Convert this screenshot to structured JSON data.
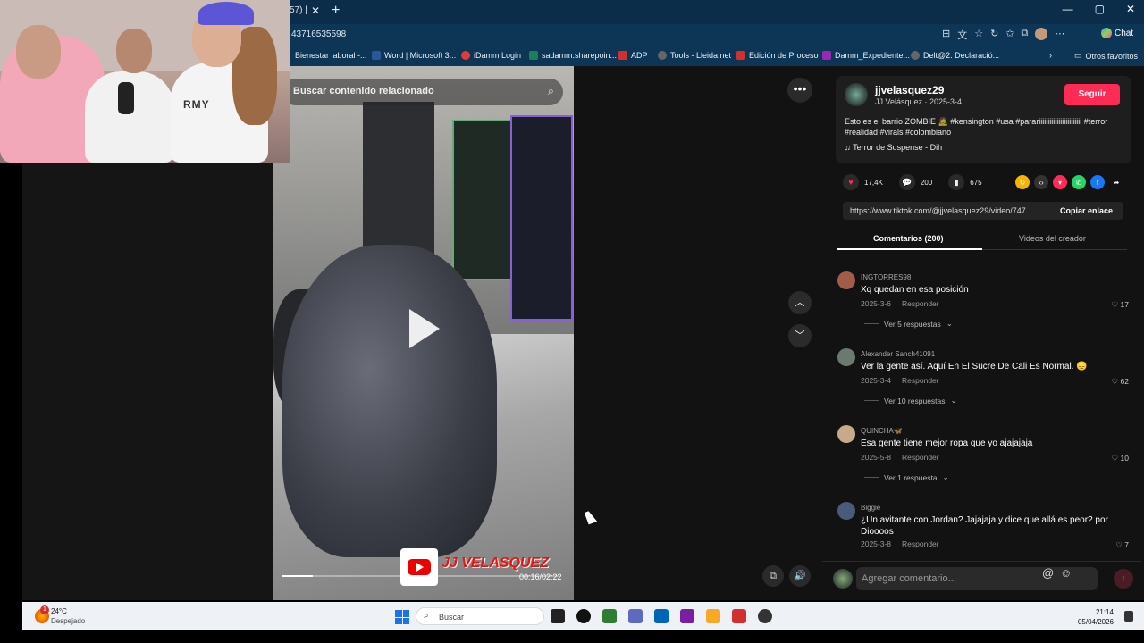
{
  "browser": {
    "tab_fragment": "57) | ",
    "tab_close": "✕",
    "new_tab": "+",
    "url_fragment": "43716535598",
    "window_controls": [
      "—",
      "▢",
      "✕"
    ],
    "chat_label": "Chat",
    "bookmarks": [
      {
        "label": "Bienestar laboral -...",
        "color": "#0b3a5c"
      },
      {
        "label": "Word | Microsoft 3...",
        "color": "#2b579a"
      },
      {
        "label": "iDamm Login",
        "color": "#e53935"
      },
      {
        "label": "sadamm.sharepoin...",
        "color": "#1b7f5b"
      },
      {
        "label": "ADP",
        "color": "#d32f2f"
      },
      {
        "label": "Tools - Lleida.net",
        "color": "#666666"
      },
      {
        "label": "Edición de Proceso",
        "color": "#d32f2f"
      },
      {
        "label": "Damm_Expediente...",
        "color": "#9c27b0"
      },
      {
        "label": "Delt@2. Declaració...",
        "color": "#666666"
      }
    ],
    "other_bookmarks": "Otros favoritos"
  },
  "video": {
    "search_placeholder": "Buscar contenido relacionado",
    "watermark": "JJ VELASQUEZ",
    "timecode": "00:16/02:22",
    "progress": 0.11,
    "more_label": "•••"
  },
  "creator": {
    "handle": "jjvelasquez29",
    "name_date": "JJ Velásquez · 2025-3-4",
    "follow_label": "Seguir",
    "caption": "Esto es el barrio ZOMBIE 🧟 #kensington #usa #parariiiiiiiiiiiiiiiiiiiiiiii #terror #realidad #virals #colombiano",
    "music": "♫  Terror de Suspense - Dih"
  },
  "stats": {
    "likes": "17,4K",
    "comments": "200",
    "saves": "675"
  },
  "link": {
    "url": "https://www.tiktok.com/@jjvelasquez29/video/747...",
    "copy_label": "Copiar enlace"
  },
  "tabs": {
    "comments_label": "Comentarios (200)",
    "creator_videos_label": "Videos del creador"
  },
  "comments": [
    {
      "user": "INGTORRES98",
      "text": "Xq quedan en esa posición",
      "date": "2025-3-6",
      "reply": "Responder",
      "likes": "17",
      "replies_label": "Ver 5 respuestas",
      "avatar_color": "#a35c4a"
    },
    {
      "user": "Alexander Sanch41091",
      "text": "Ver la gente así. Aquí En El Sucre De Cali Es Normal. 😞",
      "date": "2025-3-4",
      "reply": "Responder",
      "likes": "62",
      "replies_label": "Ver 10 respuestas",
      "avatar_color": "#6a7a6e"
    },
    {
      "user": "QUINCHA🦋",
      "text": "Esa gente tiene mejor ropa que yo ajajajaja",
      "date": "2025-5-8",
      "reply": "Responder",
      "likes": "10",
      "replies_label": "Ver 1 respuesta",
      "avatar_color": "#c9a98c"
    },
    {
      "user": "Biggie",
      "text": "¿Un avitante con Jordan? Jajajaja y dice que allá es peor? por Dioooos",
      "date": "2025-3-8",
      "reply": "Responder",
      "likes": "7",
      "replies_label": "",
      "avatar_color": "#4a5a7a"
    }
  ],
  "comment_input": {
    "placeholder": "Agregar comentario..."
  },
  "webcam": {
    "shirt_text": "RMY"
  },
  "taskbar": {
    "weather_temp": "24°C",
    "weather_desc": "Despejado",
    "weather_badge": "1",
    "search_label": "Buscar",
    "time": "21:14",
    "date": "05/04/2026",
    "apps": [
      "#222222",
      "#111111",
      "#2e7d32",
      "#5c6bc0",
      "#0067b8",
      "#7b1fa2",
      "#f9a825",
      "#d32f2f",
      "#333333"
    ]
  }
}
